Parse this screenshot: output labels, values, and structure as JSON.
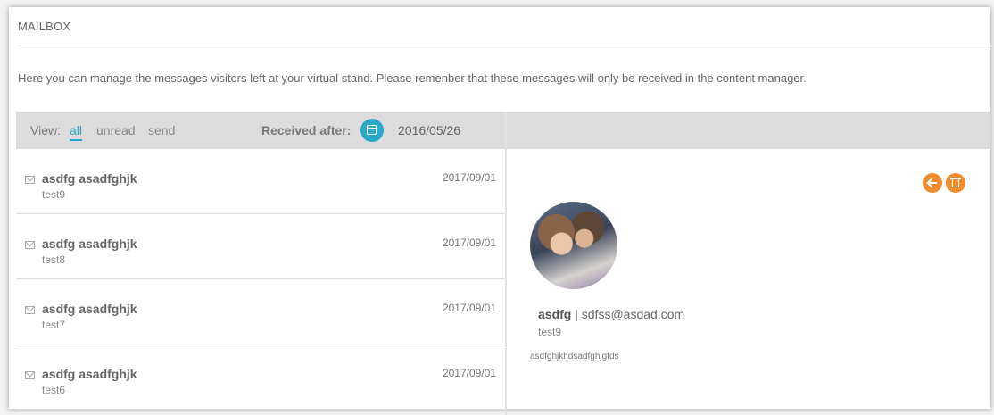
{
  "header": {
    "title": "MAILBOX",
    "description": "Here you can manage the messages visitors left at your virtual stand. Please remenber that these messages will only be received in the content manager."
  },
  "toolbar": {
    "view_label": "View:",
    "view_options": [
      "all",
      "unread",
      "send"
    ],
    "active_view": "all",
    "received_after_label": "Received after:",
    "received_after_date": "2016/05/26",
    "calendar_icon": "calendar-icon",
    "accent_color": "#29a8c7"
  },
  "messages": [
    {
      "from": "asdfg asadfghjk",
      "subject": "test9",
      "date": "2017/09/01"
    },
    {
      "from": "asdfg asadfghjk",
      "subject": "test8",
      "date": "2017/09/01"
    },
    {
      "from": "asdfg asadfghjk",
      "subject": "test7",
      "date": "2017/09/01"
    },
    {
      "from": "asdfg asadfghjk",
      "subject": "test6",
      "date": "2017/09/01"
    }
  ],
  "detail": {
    "sender_name": "asdfg",
    "separator": " | ",
    "sender_email": "sdfss@asdad.com",
    "subject": "test9",
    "body": "asdfghjkhdsadfghjgfds",
    "reply_icon": "reply-icon",
    "delete_icon": "trash-icon",
    "action_color": "#f08c2e"
  }
}
